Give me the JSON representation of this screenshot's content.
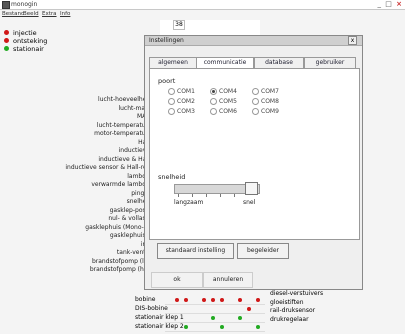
{
  "app": {
    "title": "monogin",
    "controls": {
      "minimize": "_",
      "maximize": "□",
      "close": "×"
    }
  },
  "menu": [
    "Bestand",
    "Beeld",
    "Extra",
    "Info"
  ],
  "header_box": "38",
  "legend": [
    {
      "label": "injectie",
      "color": "#d01818"
    },
    {
      "label": "ontsteking",
      "color": "#d01818"
    },
    {
      "label": "stationair",
      "color": "#22aa22"
    }
  ],
  "sensors": [
    "lucht-hoeveelheids",
    "lucht-massa",
    "MAP-s",
    "lucht-temperatuurs",
    "motor-temperatuurs",
    "Hall-s",
    "inductieve s",
    "inductieve & Hall-s",
    "inductieve sensor & Hall-refer",
    "lambda-s",
    "verwarmde lambda-s",
    "pingel-s",
    "snelheids",
    "gasklep-positie",
    "nul- & vollastco",
    "gasklephuis (Mono-Mot",
    "gasklephuis (M",
    "injec",
    "tank-ventilat",
    "brandstofpomp (lage",
    "brandstofpomp (hoge"
  ],
  "grid_rows": [
    {
      "label": "bobine",
      "dots": [
        "#d01818",
        "#d01818",
        "",
        "#d01818",
        "#d01818",
        "#d01818",
        "",
        "#d01818",
        "",
        "#d01818"
      ]
    },
    {
      "label": "DIS-bobine",
      "dots": [
        "",
        "",
        "",
        "",
        "",
        "",
        "",
        "",
        "#d01818",
        ""
      ]
    },
    {
      "label": "stationair klep 1",
      "dots": [
        "",
        "",
        "",
        "",
        "#22aa22",
        "",
        "",
        "#22aa22",
        "",
        ""
      ]
    },
    {
      "label": "stationair klep 2",
      "dots": [
        "",
        "#22aa22",
        "",
        "",
        "",
        "#22aa22",
        "",
        "",
        "",
        "#22aa22"
      ]
    }
  ],
  "right_list": [
    "diesel-verstuivers",
    "gloeistiften",
    "rail-druksensor",
    "drukregelaar"
  ],
  "dialog": {
    "title": "Instellingen",
    "close_label": "x",
    "tabs": [
      "algemeen",
      "communicatie",
      "database",
      "gebruiker"
    ],
    "active_tab": 1,
    "poort_label": "poort",
    "ports": [
      [
        {
          "label": "COM1",
          "selected": false
        },
        {
          "label": "COM4",
          "selected": true
        },
        {
          "label": "COM7",
          "selected": false
        }
      ],
      [
        {
          "label": "COM2",
          "selected": false
        },
        {
          "label": "COM5",
          "selected": false
        },
        {
          "label": "COM8",
          "selected": false
        }
      ],
      [
        {
          "label": "COM3",
          "selected": false
        },
        {
          "label": "COM6",
          "selected": false
        },
        {
          "label": "COM9",
          "selected": false
        }
      ]
    ],
    "snelheid_label": "snelheid",
    "slider_min_label": "langzaam",
    "slider_max_label": "snel",
    "slider_value": 0.9,
    "btn_default": "standaard instelling",
    "btn_guide": "begeleider",
    "btn_ok": "ok",
    "btn_cancel": "annuleren"
  }
}
